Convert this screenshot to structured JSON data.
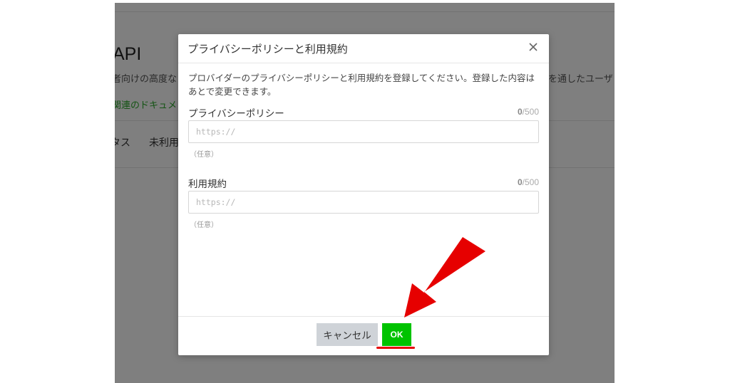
{
  "background": {
    "title": "API",
    "desc_left": "者向けの高度な",
    "desc_right": "を通したユーザ",
    "doc_link": "関連のドキュメ",
    "tab1": "タス",
    "tab2": "未利用"
  },
  "modal": {
    "title": "プライバシーポリシーと利用規約",
    "close_icon": "close-icon",
    "intro": "プロバイダーのプライバシーポリシーと利用規約を登録してください。登録した内容はあとで変更できます。",
    "privacy": {
      "label": "プライバシーポリシー",
      "count": "0",
      "max": "/500",
      "placeholder": "https://",
      "value": "",
      "hint": "（任意）"
    },
    "terms": {
      "label": "利用規約",
      "count": "0",
      "max": "/500",
      "placeholder": "https://",
      "value": "",
      "hint": "（任意）"
    },
    "cancel_label": "キャンセル",
    "ok_label": "OK"
  },
  "colors": {
    "ok_button": "#00c300",
    "cancel_button": "#cfd3d8",
    "annotation_arrow": "#e60000",
    "overlay": "rgba(0,0,0,0.5)"
  }
}
